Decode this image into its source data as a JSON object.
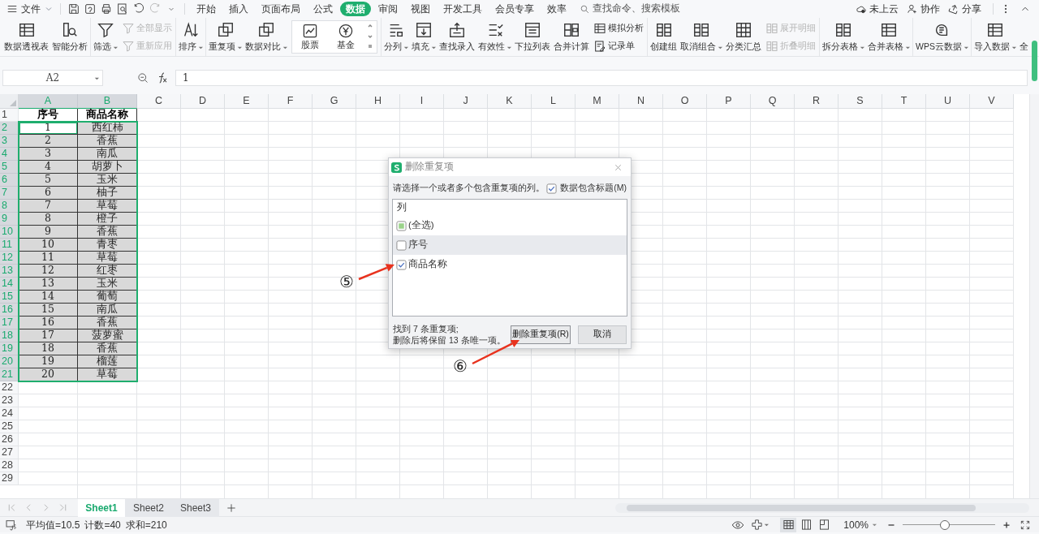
{
  "menu_bar": {
    "menu_label": "文件",
    "tabs": [
      {
        "label": "开始",
        "selected": false
      },
      {
        "label": "插入",
        "selected": false
      },
      {
        "label": "页面布局",
        "selected": false
      },
      {
        "label": "公式",
        "selected": false
      },
      {
        "label": "数据",
        "selected": true
      },
      {
        "label": "审阅",
        "selected": false
      },
      {
        "label": "视图",
        "selected": false
      },
      {
        "label": "开发工具",
        "selected": false
      },
      {
        "label": "会员专享",
        "selected": false
      },
      {
        "label": "效率",
        "selected": false
      }
    ],
    "search": {
      "placeholder": "查找命令、搜索模板"
    },
    "actions": [
      {
        "label": "未上云"
      },
      {
        "label": "协作"
      },
      {
        "label": "分享"
      }
    ]
  },
  "ribbon": {
    "groups": [
      {
        "items": [
          {
            "kind": "large",
            "label": "数据透视表",
            "dropdown": false,
            "disabled": false
          },
          {
            "kind": "large",
            "label": "智能分析",
            "dropdown": false,
            "disabled": false
          }
        ]
      },
      {
        "items": [
          {
            "kind": "large",
            "label": "筛选",
            "dropdown": true,
            "disabled": false
          },
          {
            "kind": "stack",
            "items": [
              {
                "label": "全部显示",
                "dropdown": false,
                "disabled": true
              },
              {
                "label": "重新应用",
                "dropdown": false,
                "disabled": true
              }
            ]
          }
        ]
      },
      {
        "items": [
          {
            "kind": "large",
            "label": "排序",
            "dropdown": true,
            "disabled": false
          }
        ]
      },
      {
        "items": [
          {
            "kind": "large",
            "label": "重复项",
            "dropdown": true,
            "disabled": false
          },
          {
            "kind": "large",
            "label": "数据对比",
            "dropdown": true,
            "disabled": false
          },
          {
            "kind": "gallery",
            "items": [
              {
                "label": "股票"
              },
              {
                "label": "基金"
              }
            ]
          }
        ]
      },
      {
        "items": [
          {
            "kind": "large",
            "label": "分列",
            "dropdown": true,
            "disabled": false
          },
          {
            "kind": "large",
            "label": "填充",
            "dropdown": true,
            "disabled": false
          },
          {
            "kind": "large",
            "label": "查找录入",
            "dropdown": false,
            "disabled": false
          },
          {
            "kind": "large",
            "label": "有效性",
            "dropdown": true,
            "disabled": false
          },
          {
            "kind": "large",
            "label": "下拉列表",
            "dropdown": false,
            "disabled": false
          },
          {
            "kind": "large",
            "label": "合并计算",
            "dropdown": false,
            "disabled": false
          },
          {
            "kind": "stack",
            "items": [
              {
                "label": "模拟分析",
                "dropdown": false,
                "disabled": false
              },
              {
                "label": "记录单",
                "dropdown": false,
                "disabled": false
              }
            ]
          }
        ]
      },
      {
        "items": [
          {
            "kind": "large",
            "label": "创建组",
            "dropdown": false,
            "disabled": false
          },
          {
            "kind": "large",
            "label": "取消组合",
            "dropdown": true,
            "disabled": false
          },
          {
            "kind": "large",
            "label": "分类汇总",
            "dropdown": false,
            "disabled": false
          },
          {
            "kind": "stack",
            "items": [
              {
                "label": "展开明细",
                "dropdown": false,
                "disabled": true
              },
              {
                "label": "折叠明细",
                "dropdown": false,
                "disabled": true
              }
            ]
          }
        ]
      },
      {
        "items": [
          {
            "kind": "large",
            "label": "拆分表格",
            "dropdown": true,
            "disabled": false
          },
          {
            "kind": "large",
            "label": "合并表格",
            "dropdown": true,
            "disabled": false
          }
        ]
      },
      {
        "items": [
          {
            "kind": "large",
            "label": "WPS云数据",
            "dropdown": true,
            "disabled": false
          }
        ]
      },
      {
        "items": [
          {
            "kind": "large",
            "label": "导入数据",
            "dropdown": true,
            "disabled": false
          },
          {
            "kind": "large",
            "label": "全",
            "dropdown": false,
            "disabled": false
          }
        ]
      }
    ]
  },
  "formula_bar": {
    "name_box": "A2",
    "formula": "1"
  },
  "sheet": {
    "columns": [
      {
        "label": "A",
        "selected": true
      },
      {
        "label": "B",
        "selected": true
      },
      {
        "label": "C",
        "selected": false
      },
      {
        "label": "D",
        "selected": false
      },
      {
        "label": "E",
        "selected": false
      },
      {
        "label": "F",
        "selected": false
      },
      {
        "label": "G",
        "selected": false
      },
      {
        "label": "H",
        "selected": false
      },
      {
        "label": "I",
        "selected": false
      },
      {
        "label": "J",
        "selected": false
      },
      {
        "label": "K",
        "selected": false
      },
      {
        "label": "L",
        "selected": false
      },
      {
        "label": "M",
        "selected": false
      },
      {
        "label": "N",
        "selected": false
      },
      {
        "label": "O",
        "selected": false
      },
      {
        "label": "P",
        "selected": false
      },
      {
        "label": "Q",
        "selected": false
      },
      {
        "label": "R",
        "selected": false
      },
      {
        "label": "S",
        "selected": false
      },
      {
        "label": "T",
        "selected": false
      },
      {
        "label": "U",
        "selected": false
      },
      {
        "label": "V",
        "selected": false
      }
    ],
    "rows": [
      {
        "label": "1",
        "selected": false,
        "cells": [
          {
            "text": "序号",
            "active": false
          },
          {
            "text": "商品名称",
            "active": false
          }
        ]
      },
      {
        "label": "2",
        "selected": true,
        "cells": [
          {
            "text": "1",
            "active": true
          },
          {
            "text": "西红柿",
            "active": false
          }
        ]
      },
      {
        "label": "3",
        "selected": true,
        "cells": [
          {
            "text": "2",
            "active": false
          },
          {
            "text": "香蕉",
            "active": false
          }
        ]
      },
      {
        "label": "4",
        "selected": true,
        "cells": [
          {
            "text": "3",
            "active": false
          },
          {
            "text": "南瓜",
            "active": false
          }
        ]
      },
      {
        "label": "5",
        "selected": true,
        "cells": [
          {
            "text": "4",
            "active": false
          },
          {
            "text": "胡萝卜",
            "active": false
          }
        ]
      },
      {
        "label": "6",
        "selected": true,
        "cells": [
          {
            "text": "5",
            "active": false
          },
          {
            "text": "玉米",
            "active": false
          }
        ]
      },
      {
        "label": "7",
        "selected": true,
        "cells": [
          {
            "text": "6",
            "active": false
          },
          {
            "text": "柚子",
            "active": false
          }
        ]
      },
      {
        "label": "8",
        "selected": true,
        "cells": [
          {
            "text": "7",
            "active": false
          },
          {
            "text": "草莓",
            "active": false
          }
        ]
      },
      {
        "label": "9",
        "selected": true,
        "cells": [
          {
            "text": "8",
            "active": false
          },
          {
            "text": "橙子",
            "active": false
          }
        ]
      },
      {
        "label": "10",
        "selected": true,
        "cells": [
          {
            "text": "9",
            "active": false
          },
          {
            "text": "香蕉",
            "active": false
          }
        ]
      },
      {
        "label": "11",
        "selected": true,
        "cells": [
          {
            "text": "10",
            "active": false
          },
          {
            "text": "青枣",
            "active": false
          }
        ]
      },
      {
        "label": "12",
        "selected": true,
        "cells": [
          {
            "text": "11",
            "active": false
          },
          {
            "text": "草莓",
            "active": false
          }
        ]
      },
      {
        "label": "13",
        "selected": true,
        "cells": [
          {
            "text": "12",
            "active": false
          },
          {
            "text": "红枣",
            "active": false
          }
        ]
      },
      {
        "label": "14",
        "selected": true,
        "cells": [
          {
            "text": "13",
            "active": false
          },
          {
            "text": "玉米",
            "active": false
          }
        ]
      },
      {
        "label": "15",
        "selected": true,
        "cells": [
          {
            "text": "14",
            "active": false
          },
          {
            "text": "葡萄",
            "active": false
          }
        ]
      },
      {
        "label": "16",
        "selected": true,
        "cells": [
          {
            "text": "15",
            "active": false
          },
          {
            "text": "南瓜",
            "active": false
          }
        ]
      },
      {
        "label": "17",
        "selected": true,
        "cells": [
          {
            "text": "16",
            "active": false
          },
          {
            "text": "香蕉",
            "active": false
          }
        ]
      },
      {
        "label": "18",
        "selected": true,
        "cells": [
          {
            "text": "17",
            "active": false
          },
          {
            "text": "菠萝蜜",
            "active": false
          }
        ]
      },
      {
        "label": "19",
        "selected": true,
        "cells": [
          {
            "text": "18",
            "active": false
          },
          {
            "text": "香蕉",
            "active": false
          }
        ]
      },
      {
        "label": "20",
        "selected": true,
        "cells": [
          {
            "text": "19",
            "active": false
          },
          {
            "text": "榴莲",
            "active": false
          }
        ]
      },
      {
        "label": "21",
        "selected": true,
        "cells": [
          {
            "text": "20",
            "active": false
          },
          {
            "text": "草莓",
            "active": false
          }
        ]
      },
      {
        "label": "22",
        "selected": false
      },
      {
        "label": "23",
        "selected": false
      },
      {
        "label": "24",
        "selected": false
      },
      {
        "label": "25",
        "selected": false
      },
      {
        "label": "26",
        "selected": false
      },
      {
        "label": "27",
        "selected": false
      },
      {
        "label": "28",
        "selected": false
      },
      {
        "label": "29",
        "selected": false
      }
    ]
  },
  "dialog": {
    "title": "删除重复项",
    "instruction": "请选择一个或者多个包含重复项的列。",
    "header_option": {
      "label": "数据包含标题(M)",
      "checked": true
    },
    "list_header": "列",
    "items": [
      {
        "label": "(全选)",
        "checked": false,
        "indeterminate": true,
        "highlighted": false
      },
      {
        "label": "序号",
        "checked": false,
        "indeterminate": false,
        "highlighted": true
      },
      {
        "label": "商品名称",
        "checked": true,
        "indeterminate": false,
        "highlighted": false
      }
    ],
    "summary": [
      "找到 7 条重复项;",
      "删除后将保留 13 条唯一项。"
    ],
    "buttons": [
      {
        "label": "删除重复项(R)",
        "primary": true
      },
      {
        "label": "取消",
        "primary": false
      }
    ]
  },
  "annotations": [
    {
      "label": "⑤"
    },
    {
      "label": "⑥"
    }
  ],
  "sheet_tabs": [
    {
      "label": "Sheet1",
      "selected": true
    },
    {
      "label": "Sheet2",
      "selected": false
    },
    {
      "label": "Sheet3",
      "selected": false
    }
  ],
  "status_bar": {
    "stats": [
      "平均值=10.5",
      "计数=40",
      "求和=210"
    ],
    "view_modes": [
      {
        "selected": true
      },
      {
        "selected": false
      },
      {
        "selected": false
      }
    ],
    "zoom": "100%",
    "zoom_slider": {
      "level": 0.46
    }
  }
}
